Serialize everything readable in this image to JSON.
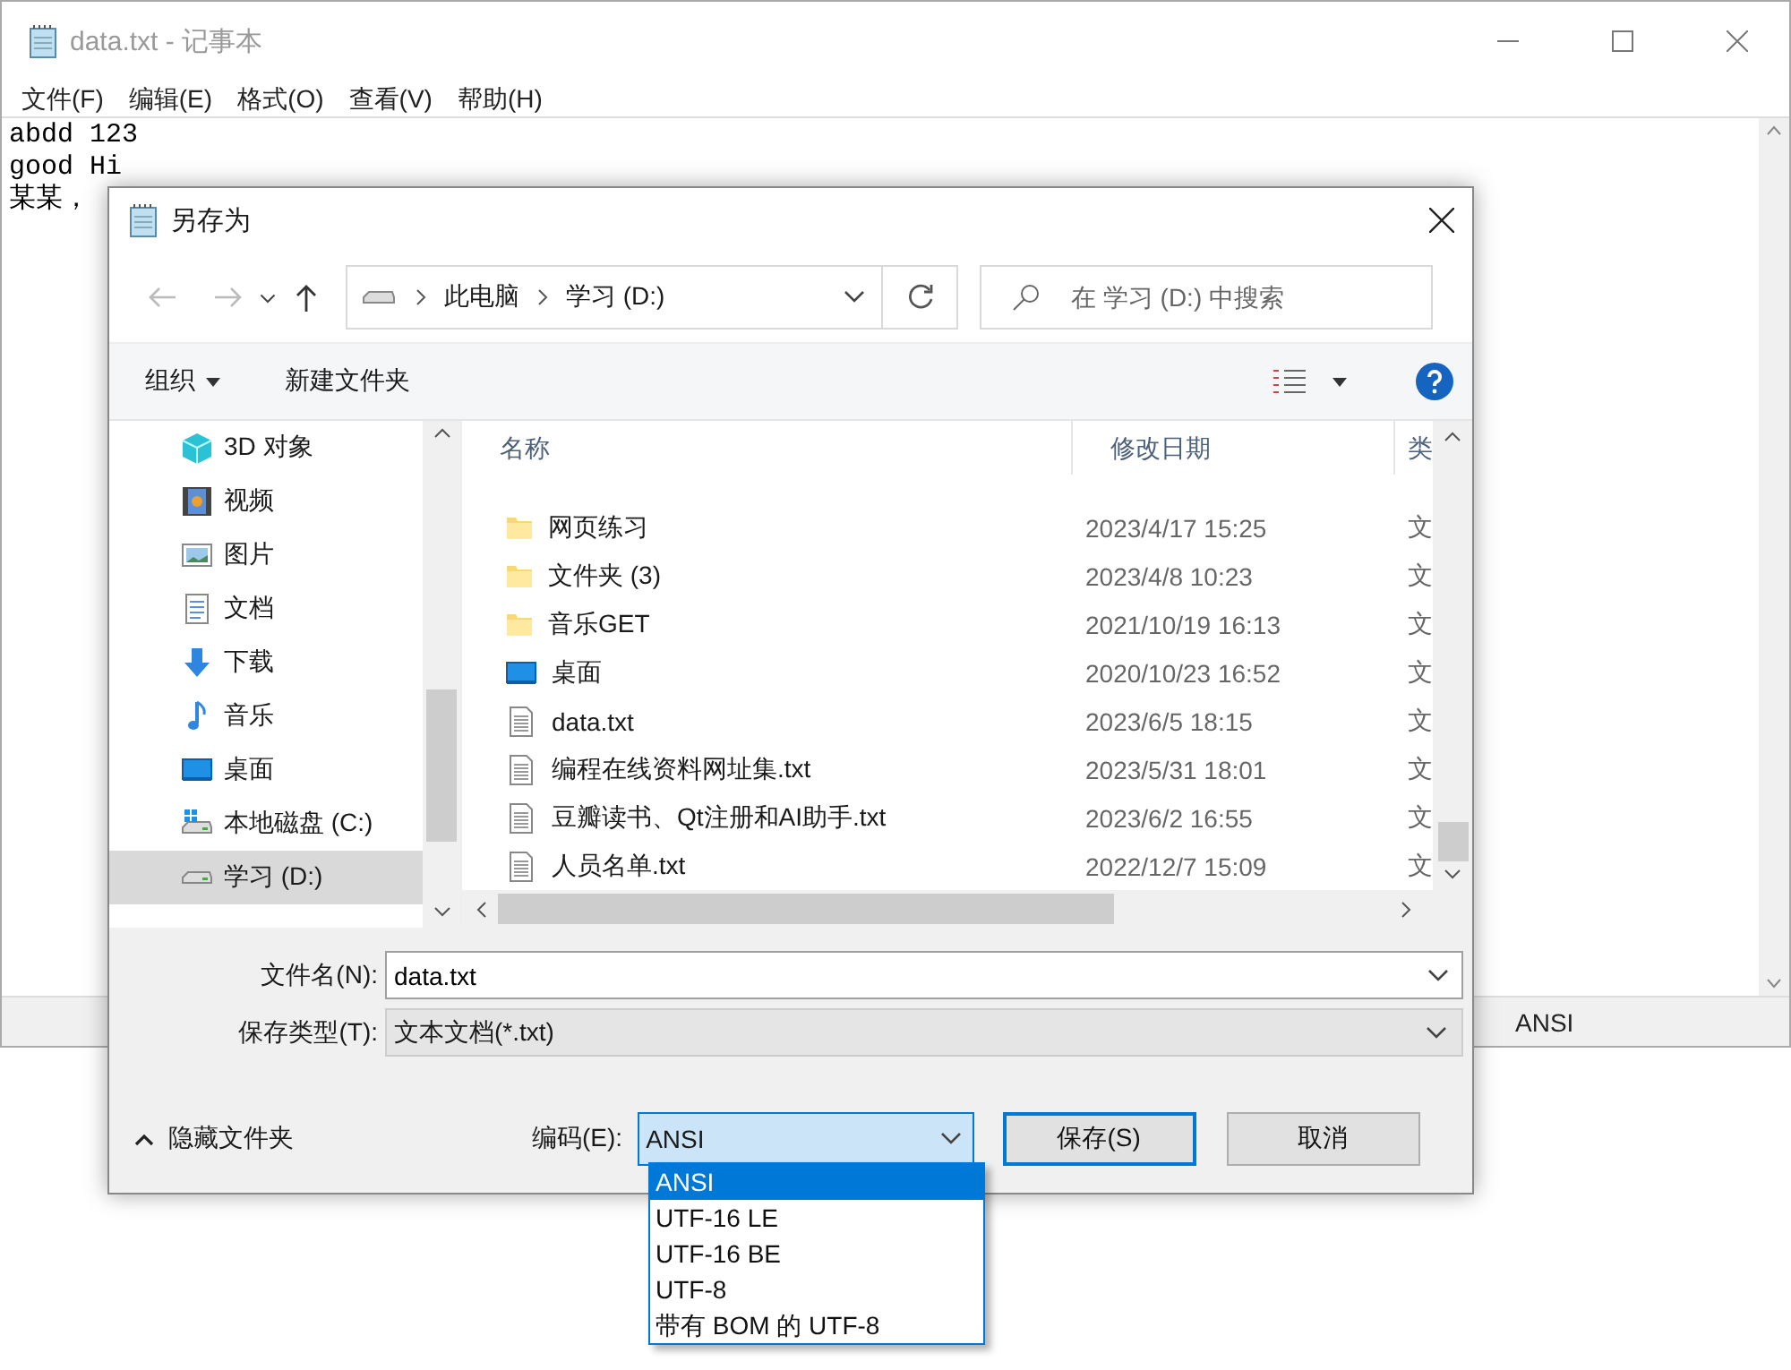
{
  "notepad": {
    "title": "data.txt - 记事本",
    "menu": [
      "文件(F)",
      "编辑(E)",
      "格式(O)",
      "查看(V)",
      "帮助(H)"
    ],
    "lines": [
      "abdd 123",
      "good Hi",
      "某某，"
    ],
    "status_encoding": "ANSI"
  },
  "dialog": {
    "title": "另存为",
    "breadcrumb": [
      "此电脑",
      "学习 (D:)"
    ],
    "search": {
      "placeholder": "在 学习 (D:) 中搜索"
    },
    "toolbar": {
      "organize": "组织",
      "new_folder": "新建文件夹"
    },
    "nav_items": [
      {
        "label": "3D 对象",
        "kind": "cube",
        "selected": false
      },
      {
        "label": "视频",
        "kind": "video",
        "selected": false
      },
      {
        "label": "图片",
        "kind": "picture",
        "selected": false
      },
      {
        "label": "文档",
        "kind": "document",
        "selected": false
      },
      {
        "label": "下载",
        "kind": "download",
        "selected": false
      },
      {
        "label": "音乐",
        "kind": "music",
        "selected": false
      },
      {
        "label": "桌面",
        "kind": "desktop",
        "selected": false
      },
      {
        "label": "本地磁盘 (C:)",
        "kind": "system-drive",
        "selected": false
      },
      {
        "label": "学习 (D:)",
        "kind": "drive",
        "selected": true
      }
    ],
    "columns": [
      "名称",
      "修改日期",
      "类"
    ],
    "files": [
      {
        "name": "网页练习",
        "kind": "folder",
        "modified": "2023/4/17 15:25",
        "type": "文"
      },
      {
        "name": "文件夹 (3)",
        "kind": "folder",
        "modified": "2023/4/8 10:23",
        "type": "文"
      },
      {
        "name": "音乐GET",
        "kind": "folder",
        "modified": "2021/10/19 16:13",
        "type": "文"
      },
      {
        "name": "桌面",
        "kind": "desktop",
        "modified": "2020/10/23 16:52",
        "type": "文"
      },
      {
        "name": "data.txt",
        "kind": "text",
        "modified": "2023/6/5 18:15",
        "type": "文"
      },
      {
        "name": "编程在线资料网址集.txt",
        "kind": "text",
        "modified": "2023/5/31 18:01",
        "type": "文"
      },
      {
        "name": "豆瓣读书、Qt注册和AI助手.txt",
        "kind": "text",
        "modified": "2023/6/2 16:55",
        "type": "文"
      },
      {
        "name": "人员名单.txt",
        "kind": "text",
        "modified": "2022/12/7 15:09",
        "type": "文"
      }
    ],
    "file_name": {
      "label": "文件名(N):",
      "value": "data.txt"
    },
    "save_type": {
      "label": "保存类型(T):",
      "value": "文本文档(*.txt)"
    },
    "hide_folders": "隐藏文件夹",
    "encoding": {
      "label": "编码(E):",
      "value": "ANSI",
      "options": [
        {
          "label": "ANSI",
          "selected": true
        },
        {
          "label": "UTF-16 LE",
          "selected": false
        },
        {
          "label": "UTF-16 BE",
          "selected": false
        },
        {
          "label": "UTF-8",
          "selected": false
        },
        {
          "label": "带有 BOM 的 UTF-8",
          "selected": false
        }
      ]
    },
    "buttons": [
      "保存(S)",
      "取消"
    ]
  }
}
